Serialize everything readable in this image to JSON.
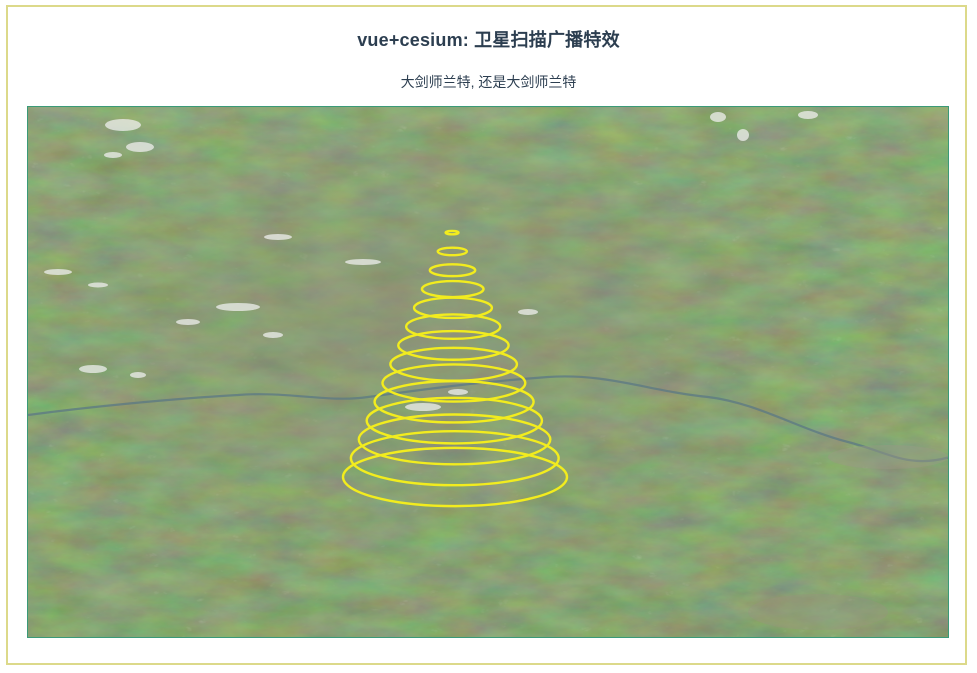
{
  "header": {
    "title": "vue+cesium: 卫星扫描广播特效",
    "subtitle": "大剑师兰特, 还是大剑师兰特"
  },
  "map": {
    "imagery": "satellite-terrain",
    "effect": {
      "type": "cone-ring-scan",
      "ring_color": "#f2ec1e",
      "ring_count": 14
    }
  },
  "colors": {
    "frame_border": "#dcd98a",
    "viewport_border": "#3a9a78",
    "title_text": "#2c3e50"
  }
}
